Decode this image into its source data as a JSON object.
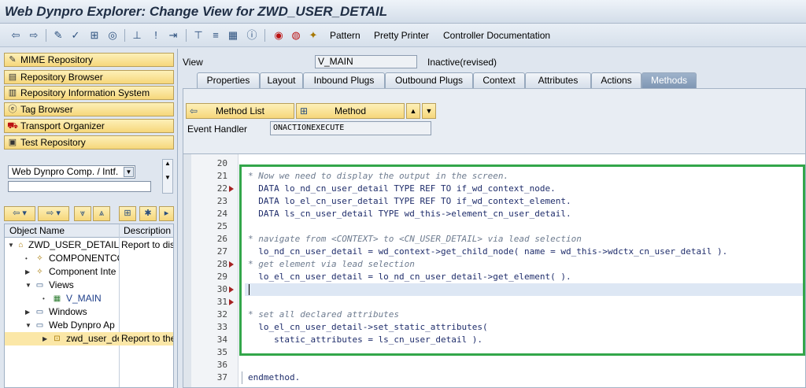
{
  "window": {
    "title": "Web Dynpro Explorer: Change View for ZWD_USER_DETAIL"
  },
  "toolbar": {
    "pattern_label": "Pattern",
    "pretty_printer_label": "Pretty Printer",
    "controller_doc_label": "Controller Documentation"
  },
  "nav": {
    "buttons": [
      "MIME Repository",
      "Repository Browser",
      "Repository Information System",
      "Tag Browser",
      "Transport Organizer",
      "Test Repository"
    ],
    "combo_value": "Web Dynpro Comp. / Intf."
  },
  "tree": {
    "col_name": "Object Name",
    "col_desc": "Description",
    "rows": [
      {
        "name": "ZWD_USER_DETAIL",
        "desc": "Report to disp"
      },
      {
        "name": "COMPONENTCO",
        "desc": ""
      },
      {
        "name": "Component Inte",
        "desc": ""
      },
      {
        "name": "Views",
        "desc": ""
      },
      {
        "name": "V_MAIN",
        "desc": ""
      },
      {
        "name": "Windows",
        "desc": ""
      },
      {
        "name": "Web Dynpro Ap",
        "desc": ""
      },
      {
        "name": "zwd_user_de",
        "desc": "Report to the"
      }
    ]
  },
  "view": {
    "label": "View",
    "name": "V_MAIN",
    "status": "Inactive(revised)"
  },
  "tabs": [
    "Properties",
    "Layout",
    "Inbound Plugs",
    "Outbound Plugs",
    "Context",
    "Attributes",
    "Actions",
    "Methods"
  ],
  "methods": {
    "method_list_label": "Method List",
    "method_label": "Method",
    "event_handler_label": "Event Handler",
    "event_handler_value": "ONACTIONEXECUTE"
  },
  "editor": {
    "lines": [
      {
        "n": "20",
        "text": ""
      },
      {
        "n": "21",
        "text": "* Now we need to display the output in the screen."
      },
      {
        "n": "22",
        "text": "  DATA lo_nd_cn_user_detail TYPE REF TO if_wd_context_node."
      },
      {
        "n": "23",
        "text": "  DATA lo_el_cn_user_detail TYPE REF TO if_wd_context_element."
      },
      {
        "n": "24",
        "text": "  DATA ls_cn_user_detail TYPE wd_this->element_cn_user_detail."
      },
      {
        "n": "25",
        "text": ""
      },
      {
        "n": "26",
        "text": "* navigate from <CONTEXT> to <CN_USER_DETAIL> via lead selection"
      },
      {
        "n": "27",
        "text": "  lo_nd_cn_user_detail = wd_context->get_child_node( name = wd_this->wdctx_cn_user_detail )."
      },
      {
        "n": "28",
        "text": "* get element via lead selection"
      },
      {
        "n": "29",
        "text": "  lo_el_cn_user_detail = lo_nd_cn_user_detail->get_element( )."
      },
      {
        "n": "30",
        "text": ""
      },
      {
        "n": "31",
        "text": ""
      },
      {
        "n": "32",
        "text": "* set all declared attributes"
      },
      {
        "n": "33",
        "text": "  lo_el_cn_user_detail->set_static_attributes("
      },
      {
        "n": "34",
        "text": "     static_attributes = ls_cn_user_detail )."
      },
      {
        "n": "35",
        "text": ""
      },
      {
        "n": "36",
        "text": ""
      },
      {
        "n": "37",
        "text": "endmethod."
      }
    ]
  }
}
